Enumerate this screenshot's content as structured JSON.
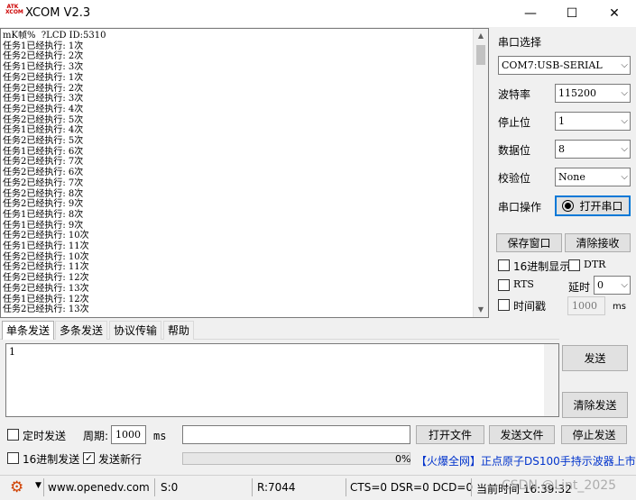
{
  "window": {
    "logo_text": "ATK\nXCOM",
    "title": "XCOM V2.3",
    "minimize": "—",
    "maximize": "☐",
    "close": "✕"
  },
  "receive": {
    "lines": [
      "mK帧%  ?LCD ID:5310",
      "任务1已经执行: 1次",
      "任务2已经执行: 2次",
      "任务1已经执行: 3次",
      "任务2已经执行: 1次",
      "任务2已经执行: 2次",
      "任务1已经执行: 3次",
      "任务2已经执行: 4次",
      "任务2已经执行: 5次",
      "任务1已经执行: 4次",
      "任务2已经执行: 5次",
      "任务1已经执行: 6次",
      "任务2已经执行: 7次",
      "任务2已经执行: 6次",
      "任务2已经执行: 7次",
      "任务2已经执行: 8次",
      "任务2已经执行: 9次",
      "任务1已经执行: 8次",
      "任务1已经执行: 9次",
      "任务2已经执行: 10次",
      "任务1已经执行: 11次",
      "任务2已经执行: 10次",
      "任务2已经执行: 11次",
      "任务2已经执行: 12次",
      "任务2已经执行: 13次",
      "任务1已经执行: 12次",
      "任务2已经执行: 13次"
    ]
  },
  "settings": {
    "port_label": "串口选择",
    "port_value": "COM7:USB-SERIAL",
    "baud_label": "波特率",
    "baud_value": "115200",
    "stop_label": "停止位",
    "stop_value": "1",
    "data_label": "数据位",
    "data_value": "8",
    "parity_label": "校验位",
    "parity_value": "None",
    "op_label": "串口操作",
    "open_button": "打开串口",
    "save_window": "保存窗口",
    "clear_receive": "清除接收",
    "hex_display": "16进制显示",
    "dtr": "DTR",
    "rts": "RTS",
    "delay_label": "延时",
    "delay_value": "0",
    "timestamp": "时间戳",
    "timestamp_value": "1000",
    "ms_unit": "ms"
  },
  "tabs": [
    "单条发送",
    "多条发送",
    "协议传输",
    "帮助"
  ],
  "send": {
    "text": "1",
    "send_button": "发送",
    "clear_send": "清除发送",
    "timed_send": "定时发送",
    "period_label": "周期:",
    "period_value": "1000",
    "ms_unit": "ms",
    "open_file": "打开文件",
    "send_file": "发送文件",
    "stop_send": "停止发送",
    "hex_send": "16进制发送",
    "new_line": "发送新行",
    "new_line_checked": true,
    "progress": "0%",
    "ad_prefix": "【火爆全网】",
    "ad_text": "正点原子DS100手持示波器上市"
  },
  "status": {
    "url": "www.openedv.com",
    "sent": "S:0",
    "received": "R:7044",
    "lines": "CTS=0 DSR=0 DCD=0",
    "time": "当前时间 16:39:32",
    "watermark": "CSDN @Lint_2025"
  }
}
